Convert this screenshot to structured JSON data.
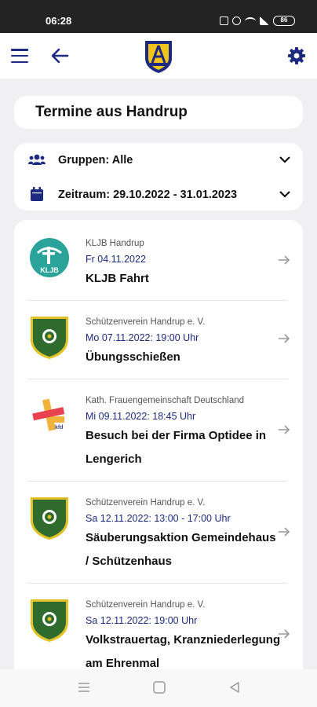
{
  "status_bar": {
    "time": "06:28",
    "battery": "86"
  },
  "header": {
    "menu_icon": "menu-icon",
    "back_icon": "arrow-left-icon",
    "logo": "handrup-crest",
    "settings_icon": "gear-icon"
  },
  "page": {
    "title": "Termine aus Handrup"
  },
  "filters": {
    "groups_label": "Gruppen: Alle",
    "period_label": "Zeitraum: 29.10.2022 - 31.01.2023"
  },
  "events": [
    {
      "org": "KLJB Handrup",
      "date": "Fr 04.11.2022",
      "title": "KLJB Fahrt",
      "logo": "kljb"
    },
    {
      "org": "Schützenverein Handrup e. V.",
      "date": "Mo 07.11.2022: 19:00 Uhr",
      "title": "Übungsschießen",
      "logo": "schuetzen"
    },
    {
      "org": "Kath. Frauengemeinschaft Deutschland",
      "date": "Mi 09.11.2022: 18:45 Uhr",
      "title": "Besuch bei der Firma Optidee in Lengerich",
      "logo": "kfd"
    },
    {
      "org": "Schützenverein Handrup e. V.",
      "date": "Sa 12.11.2022: 13:00 - 17:00 Uhr",
      "title": "Säuberungsaktion Gemeindehaus / Schützenhaus",
      "logo": "schuetzen"
    },
    {
      "org": "Schützenverein Handrup e. V.",
      "date": "Sa 12.11.2022: 19:00 Uhr",
      "title": "Volkstrauertag, Kranzniederlegung am Ehrenmal",
      "logo": "schuetzen"
    }
  ],
  "colors": {
    "accent": "#1d2a82",
    "kljb": "#2aa39a",
    "schuetzen_green": "#2e6b2c",
    "schuetzen_gold": "#e3c229"
  }
}
